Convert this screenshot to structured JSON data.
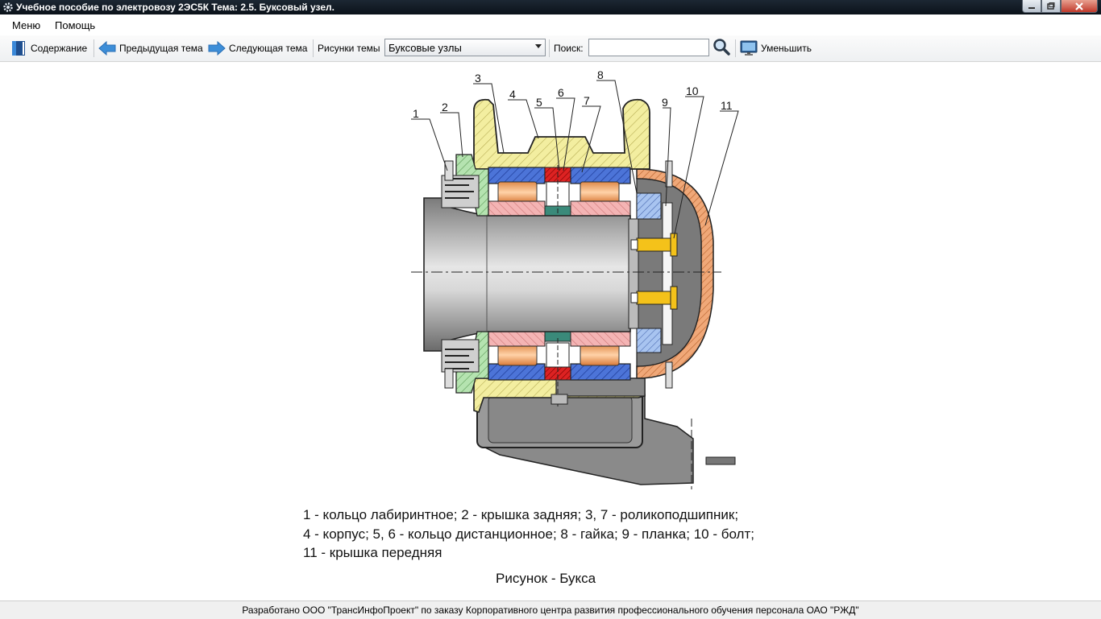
{
  "window": {
    "title": "Учебное пособие по электровозу 2ЭС5К Тема: 2.5. Буксовый узел."
  },
  "menu": {
    "items": [
      "Меню",
      "Помощь"
    ]
  },
  "toolbar": {
    "contents_label": "Содержание",
    "prev_label": "Предыдущая тема",
    "next_label": "Следующая тема",
    "figures_label": "Рисунки темы",
    "figures_selected": "Буксовые узлы",
    "search_label": "Поиск:",
    "search_value": "",
    "shrink_label": "Уменьшить"
  },
  "figure": {
    "callouts": [
      "1",
      "2",
      "3",
      "4",
      "5",
      "6",
      "7",
      "8",
      "9",
      "10",
      "11"
    ],
    "legend_lines": [
      "1 - кольцо лабиринтное; 2 - крышка задняя; 3, 7 - роликоподшипник;",
      "4 - корпус; 5, 6 - кольцо дистанционное; 8 - гайка; 9 - планка; 10 - болт;",
      "11 - крышка передняя"
    ],
    "title": "Рисунок - Букса"
  },
  "status": {
    "text": "Разработано ООО \"ТрансИнфоПроект\" по заказу Корпоративного центра развития профессионального обучения персонала ОАО \"РЖД\""
  },
  "colors": {
    "housing": "#f3eea0",
    "outer_ring": "#5577dd",
    "inner_ring": "#f2a9a9",
    "roller": "#f5b682",
    "spacer": "#dd2222",
    "front_cover": "#f0a878",
    "bolt": "#f4c21a",
    "labyrinth": "#b5e3b0",
    "axle_dark": "#6e6e6e",
    "axle_light": "#e2e2e2"
  }
}
